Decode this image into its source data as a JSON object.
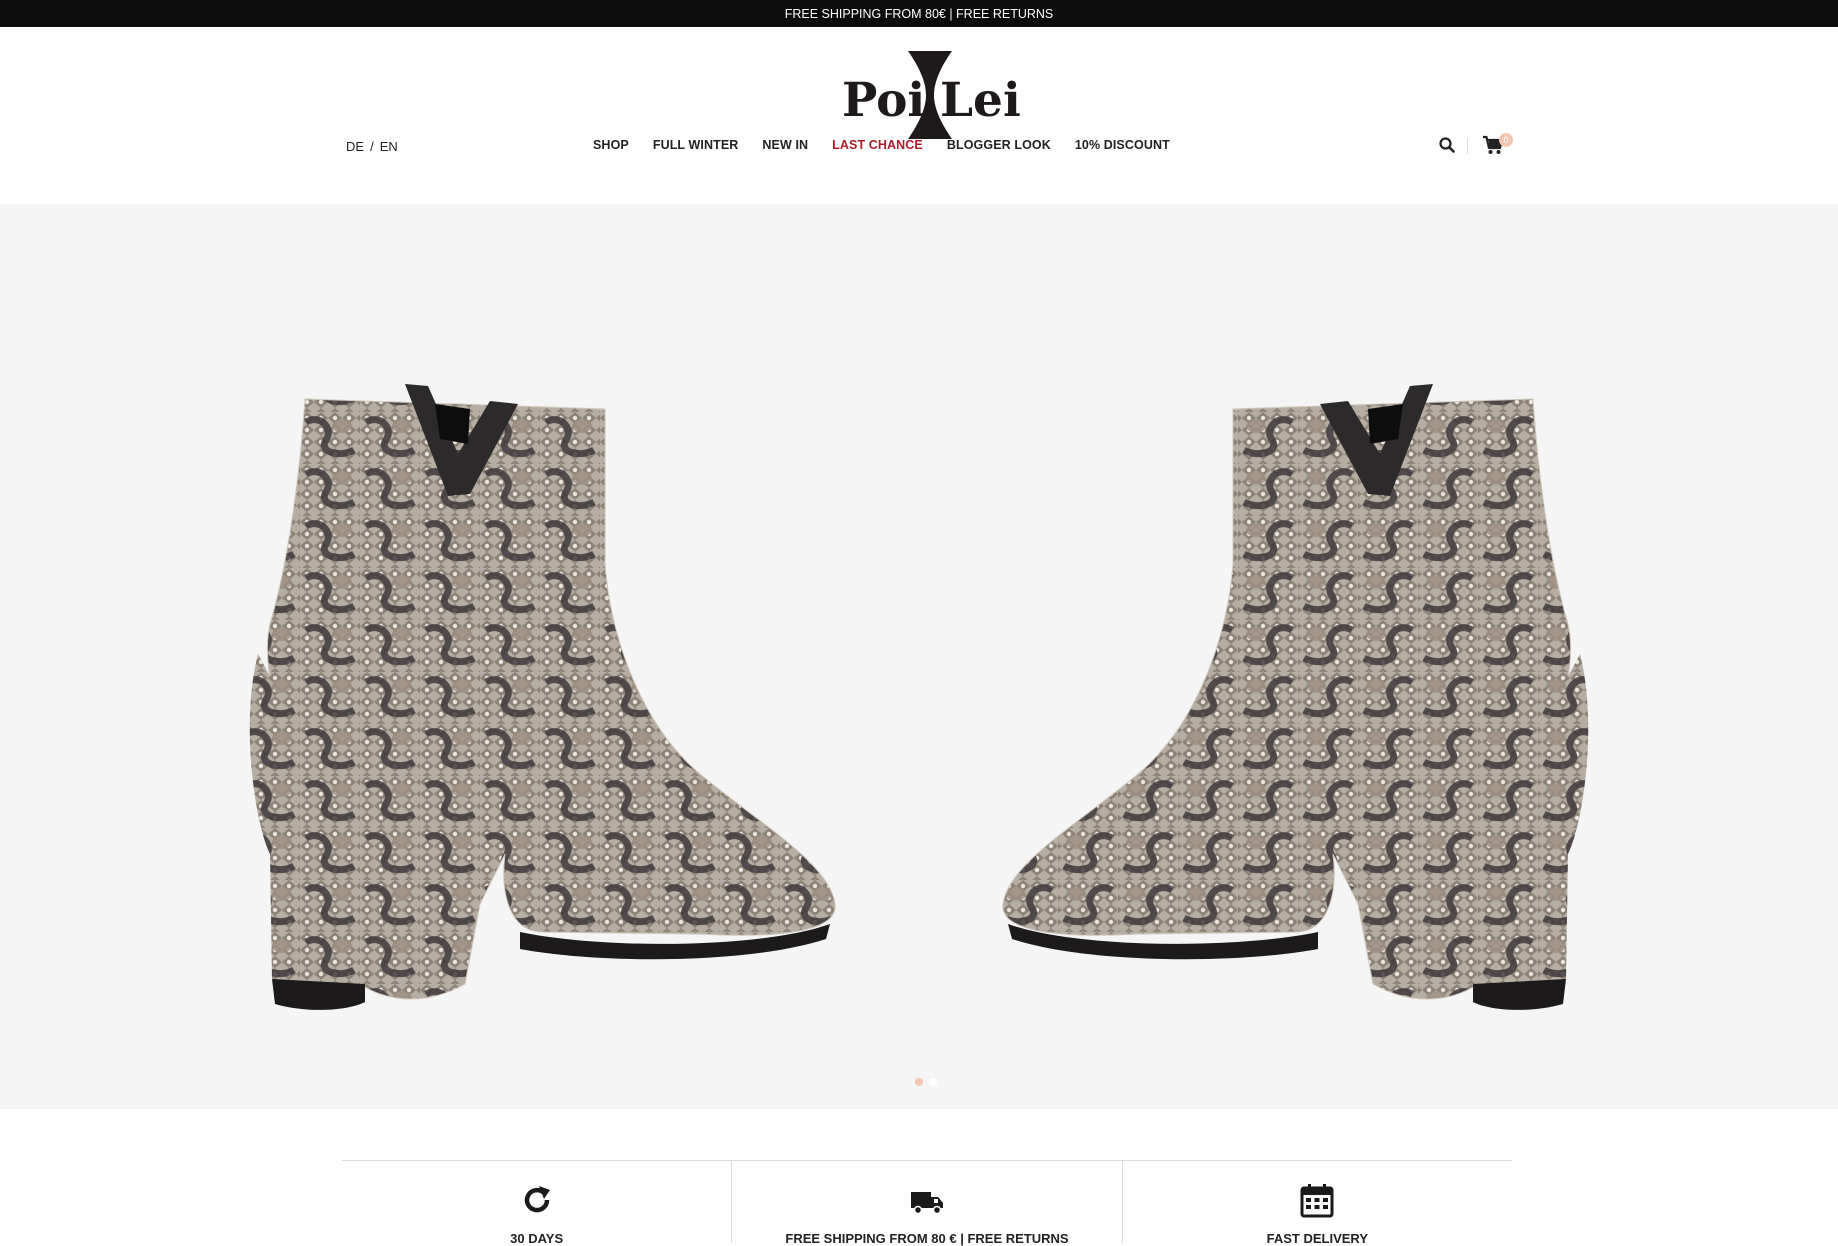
{
  "announcement": "FREE SHIPPING FROM 80€ | FREE RETURNS",
  "brand": {
    "left": "Poi",
    "right": "Lei"
  },
  "languages": {
    "de": "DE",
    "separator": "/",
    "en": "EN"
  },
  "nav": {
    "shop": "SHOP",
    "full_winter": "FULL WINTER",
    "new_in": "NEW IN",
    "last_chance": "LAST CHANCE",
    "blogger_look": "BLOGGER LOOK",
    "discount": "10% DISCOUNT"
  },
  "cart": {
    "count": "0",
    "icon": "cart-icon"
  },
  "search": {
    "icon": "search-icon"
  },
  "hero": {
    "slides": 2,
    "active_slide": 1,
    "image": "snakeskin ankle boots pair"
  },
  "features": [
    {
      "icon": "refresh-icon",
      "label": "30 DAYS"
    },
    {
      "icon": "truck-icon",
      "label": "FREE SHIPPING FROM 80 € | FREE RETURNS"
    },
    {
      "icon": "calendar-icon",
      "label": "FAST DELIVERY"
    }
  ],
  "colors": {
    "topbar": "#0c0b0c",
    "accent": "#b01c2a",
    "badge": "#f4c6b0",
    "hero_bg": "#f5f5f5"
  }
}
